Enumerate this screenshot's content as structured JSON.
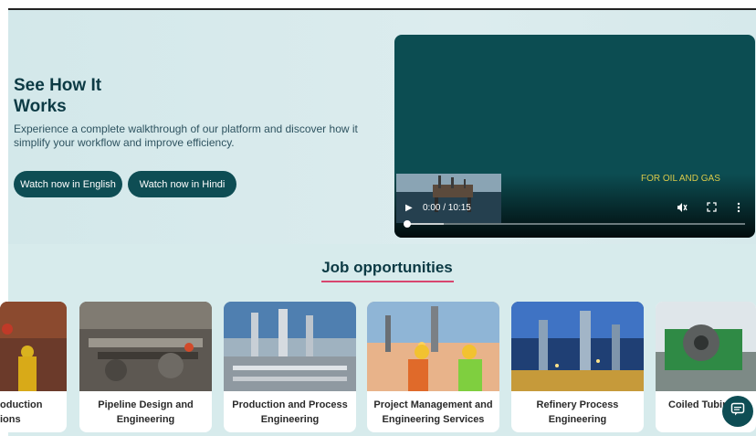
{
  "hero": {
    "title": "See How It Works",
    "description": "Experience a complete walkthrough of our platform and discover how it simplify your workflow and improve efficiency.",
    "buttons": {
      "english": "Watch now in English",
      "hindi": "Watch now in Hindi"
    }
  },
  "video": {
    "badge": "FOR OIL AND GAS",
    "time": "0:00 / 10:15",
    "progress_fraction": 0.0,
    "icons": [
      "play-icon",
      "mute-icon",
      "fullscreen-icon",
      "more-options-icon"
    ]
  },
  "jobs": {
    "title": "Job opportunities",
    "cards": [
      {
        "label": "oduction\nions"
      },
      {
        "label": "Pipeline Design and Engineering"
      },
      {
        "label": "Production and Process Engineering"
      },
      {
        "label": "Project Management and Engineering Services"
      },
      {
        "label": "Refinery Process Engineering"
      },
      {
        "label": "Coiled Tubing"
      }
    ]
  },
  "chat": {
    "icon": "chat-icon"
  },
  "colors": {
    "primary": "#0e4d54",
    "accent_underline": "#d8456f",
    "hero_bg": "#d3e8ea",
    "video_bg": "#0c4d52"
  }
}
